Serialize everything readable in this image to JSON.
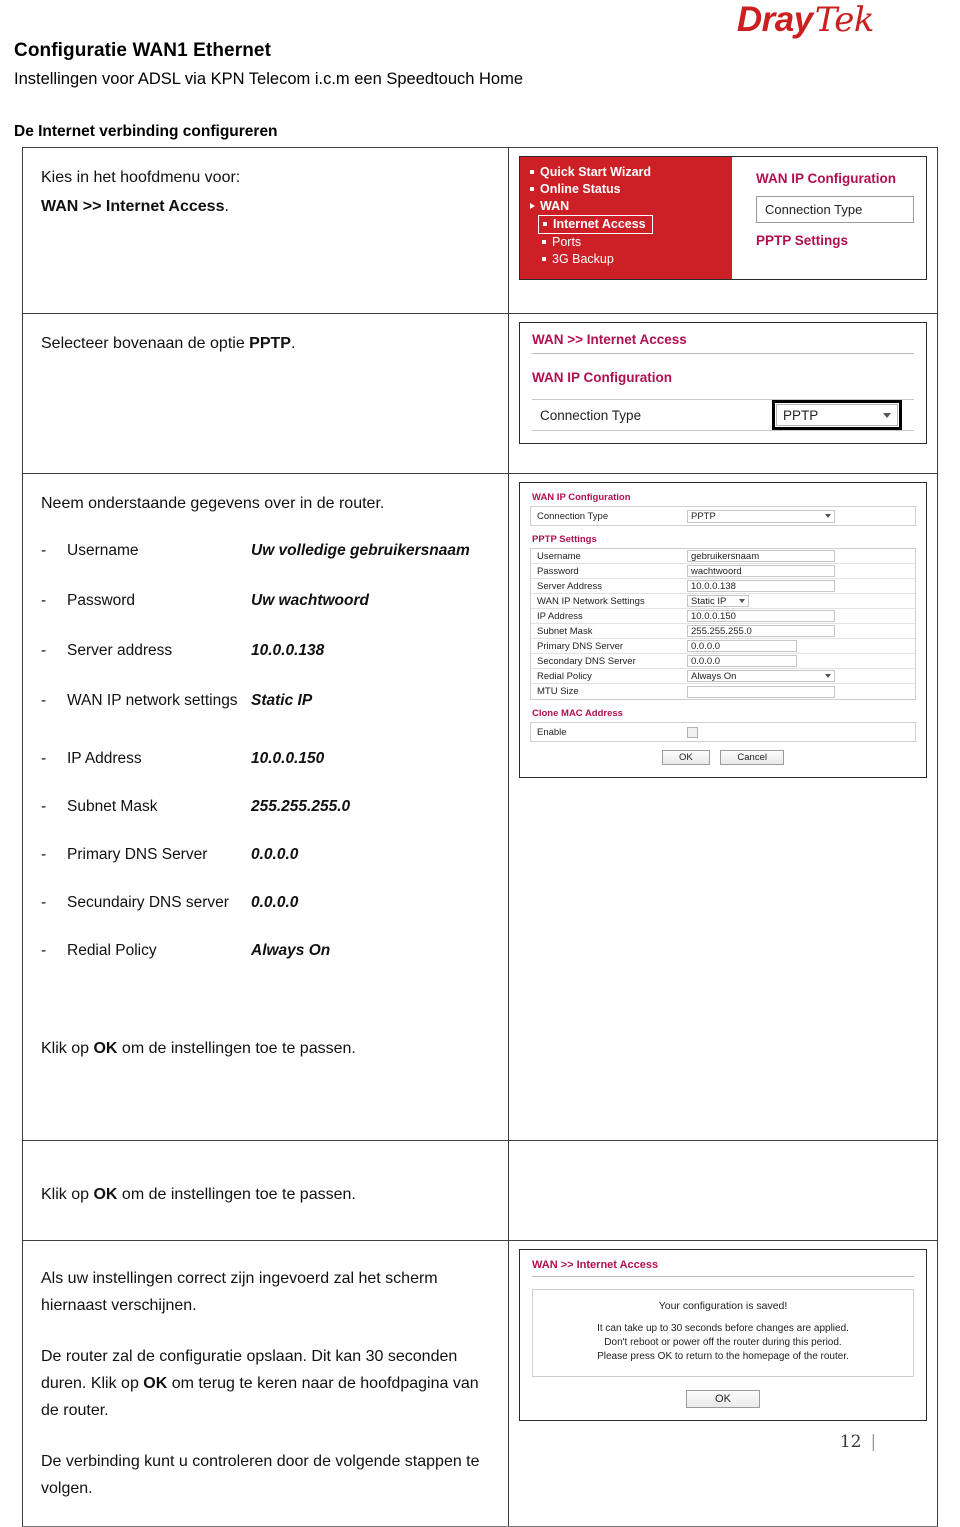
{
  "brand": {
    "name_part1": "Dray",
    "name_part2": "Tek",
    "color": "#cc1f1f"
  },
  "document": {
    "title": "Configuratie WAN1 Ethernet",
    "subtitle": "Instellingen voor ADSL via KPN Telecom i.c.m een Speedtouch Home",
    "section_heading": "De Internet verbinding configureren",
    "page_number": "12"
  },
  "steps": {
    "step1": {
      "line1": "Kies in het hoofdmenu voor:",
      "line2_bold": "WAN >> Internet Access",
      "line2_tail": "."
    },
    "step2": {
      "prefix": "Selecteer bovenaan de optie ",
      "bold": "PPTP",
      "suffix": "."
    },
    "step3": {
      "intro": "Neem onderstaande gegevens over in de router.",
      "settings": [
        {
          "dash": "-",
          "term": "Username",
          "value": "Uw volledige gebruikersnaam"
        },
        {
          "dash": "-",
          "term": "Password",
          "value": "Uw wachtwoord"
        },
        {
          "dash": "-",
          "term": "Server address",
          "value": "10.0.0.138"
        },
        {
          "dash": "-",
          "term": "WAN IP network settings",
          "value": "Static IP"
        },
        {
          "dash": "-",
          "term": "IP Address",
          "value": "10.0.0.150"
        },
        {
          "dash": "-",
          "term": "Subnet Mask",
          "value": "255.255.255.0"
        },
        {
          "dash": "-",
          "term": "Primary DNS Server",
          "value": "0.0.0.0"
        },
        {
          "dash": "-",
          "term": "Secundairy DNS server",
          "value": "0.0.0.0"
        },
        {
          "dash": "-",
          "term": "Redial Policy",
          "value": "Always On"
        }
      ],
      "outro_prefix": "Klik op ",
      "outro_bold": "OK",
      "outro_suffix": " om de instellingen toe te passen."
    },
    "step4": {
      "p1": "Als uw instellingen correct zijn ingevoerd zal het scherm hiernaast verschijnen.",
      "p2_a": "De router zal de configuratie opslaan. Dit kan 30 seconden duren. Klik op ",
      "p2_bold": "OK",
      "p2_b": " om terug te keren naar de hoofdpagina van de router.",
      "p3": "De verbinding kunt u controleren door de volgende stappen te volgen."
    }
  },
  "shot_menu": {
    "items": [
      "Quick Start Wizard",
      "Online Status",
      "WAN",
      "Internet Access",
      "Ports",
      "3G Backup"
    ],
    "panel_title": "WAN IP Configuration",
    "connection_type_label": "Connection Type",
    "pptp_settings_label": "PPTP Settings"
  },
  "shot_pptp": {
    "breadcrumb": "WAN >> Internet Access",
    "section_title": "WAN IP Configuration",
    "row_label": "Connection Type",
    "selected_value": "PPTP"
  },
  "shot_form": {
    "heading_wanip": "WAN IP Configuration",
    "conn_label": "Connection Type",
    "conn_value": "PPTP",
    "heading_pptp": "PPTP Settings",
    "rows": [
      {
        "label": "Username",
        "value": "gebruikersnaam",
        "kind": "input",
        "w": "lg"
      },
      {
        "label": "Password",
        "value": "wachtwoord",
        "kind": "input",
        "w": "lg"
      },
      {
        "label": "Server Address",
        "value": "10.0.0.138",
        "kind": "input",
        "w": "lg"
      },
      {
        "label": "WAN IP Network Settings",
        "value": "Static IP",
        "kind": "select",
        "w": "sm"
      },
      {
        "label": "IP Address",
        "value": "10.0.0.150",
        "kind": "input",
        "w": "lg"
      },
      {
        "label": "Subnet Mask",
        "value": "255.255.255.0",
        "kind": "input",
        "w": "lg"
      },
      {
        "label": "Primary DNS Server",
        "value": "0.0.0.0",
        "kind": "input",
        "w": "md"
      },
      {
        "label": "Secondary DNS Server",
        "value": "0.0.0.0",
        "kind": "input",
        "w": "md"
      },
      {
        "label": "Redial Policy",
        "value": "Always On",
        "kind": "select",
        "w": "lg"
      },
      {
        "label": "MTU Size",
        "value": "",
        "kind": "input",
        "w": "lg"
      }
    ],
    "heading_clone": "Clone MAC Address",
    "enable_label": "Enable",
    "ok_label": "OK",
    "cancel_label": "Cancel"
  },
  "shot_saved": {
    "breadcrumb": "WAN >> Internet Access",
    "headline": "Your configuration is saved!",
    "line1": "It can take up to 30 seconds before changes are applied.",
    "line2": "Don't reboot or power off the router during this period.",
    "line3": "Please press OK to return to the homepage of the router.",
    "ok_label": "OK"
  }
}
